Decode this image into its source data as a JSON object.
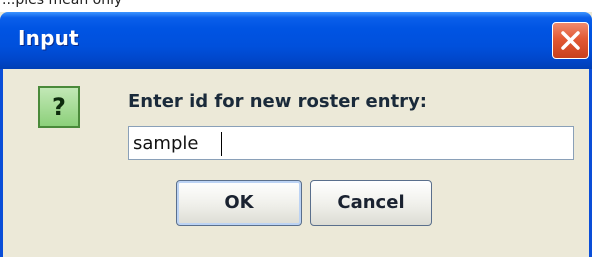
{
  "top_strip": {
    "text": "...ples mean only"
  },
  "dialog": {
    "title": "Input",
    "close_glyph": "X",
    "icon": {
      "name": "question-icon",
      "glyph": "?"
    },
    "prompt": "Enter id for new roster entry:",
    "input": {
      "value": "sample",
      "placeholder": ""
    },
    "buttons": {
      "ok_label": "OK",
      "cancel_label": "Cancel"
    }
  },
  "colors": {
    "titlebar": "#0054e3",
    "dialog_bg": "#ece9d8",
    "close_button": "#e25934",
    "question_icon": "#8cd07a"
  }
}
